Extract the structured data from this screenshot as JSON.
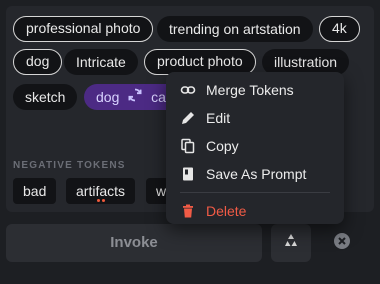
{
  "prompt_tokens": {
    "row1": [
      "professional photo",
      "trending on artstation",
      "4k"
    ],
    "row2": [
      "dog",
      "Intricate",
      "product photo",
      "illustration"
    ],
    "row3": [
      "sketch",
      "dog",
      "ca"
    ]
  },
  "negative": {
    "label": "NEGATIVE TOKENS",
    "tokens": [
      "bad",
      "artifacts",
      "w"
    ]
  },
  "actions": {
    "invoke_label": "Invoke"
  },
  "context_menu": {
    "items": [
      {
        "label": "Merge Tokens",
        "icon": "link-icon"
      },
      {
        "label": "Edit",
        "icon": "pencil-icon"
      },
      {
        "label": "Copy",
        "icon": "copy-icon"
      },
      {
        "label": "Save As Prompt",
        "icon": "book-icon"
      },
      {
        "label": "Delete",
        "icon": "trash-icon"
      }
    ]
  },
  "colors": {
    "accent_purple": "#4c2a84",
    "danger": "#f15b46"
  }
}
